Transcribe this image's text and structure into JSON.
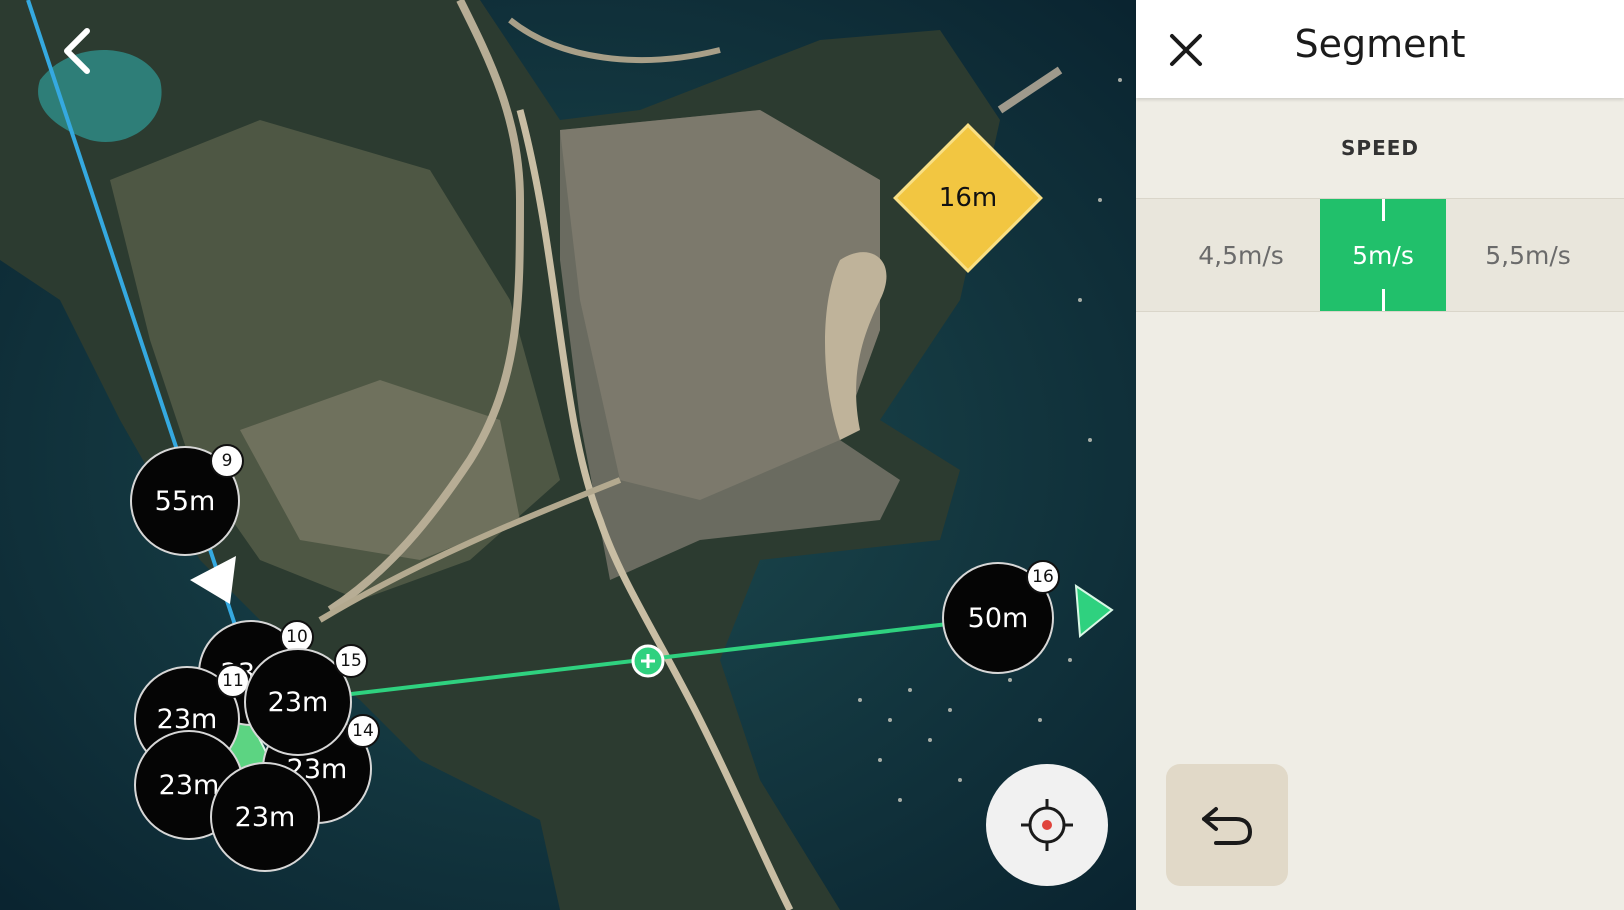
{
  "map": {
    "poi": {
      "label": "16m"
    },
    "waypoints": [
      {
        "id": "wp9",
        "altitude": "55m",
        "number": "9"
      },
      {
        "id": "wp10",
        "altitude": "23m",
        "number": "10"
      },
      {
        "id": "wp11",
        "altitude": "23m",
        "number": "11"
      },
      {
        "id": "wp12",
        "altitude": "23m",
        "number": ""
      },
      {
        "id": "wp13",
        "altitude": "23m",
        "number": ""
      },
      {
        "id": "wp14",
        "altitude": "23m",
        "number": "14"
      },
      {
        "id": "wp15",
        "altitude": "23m",
        "number": "15"
      },
      {
        "id": "wp16",
        "altitude": "50m",
        "number": "16"
      }
    ],
    "icons": {
      "back": "chevron-left-icon",
      "locate": "crosshair-icon",
      "segment_midpoint": "plus-icon"
    },
    "colors": {
      "flight_path": "#35a9e0",
      "selected_segment": "#2fd17f",
      "poi": "#f2c641"
    }
  },
  "panel": {
    "title": "Segment",
    "section_label": "SPEED",
    "speed_options": [
      "4,5m/s",
      "5m/s",
      "5,5m/s"
    ],
    "selected_speed": "5m/s",
    "icons": {
      "close": "close-icon",
      "undo": "undo-icon"
    },
    "accent_color": "#21c06b"
  }
}
